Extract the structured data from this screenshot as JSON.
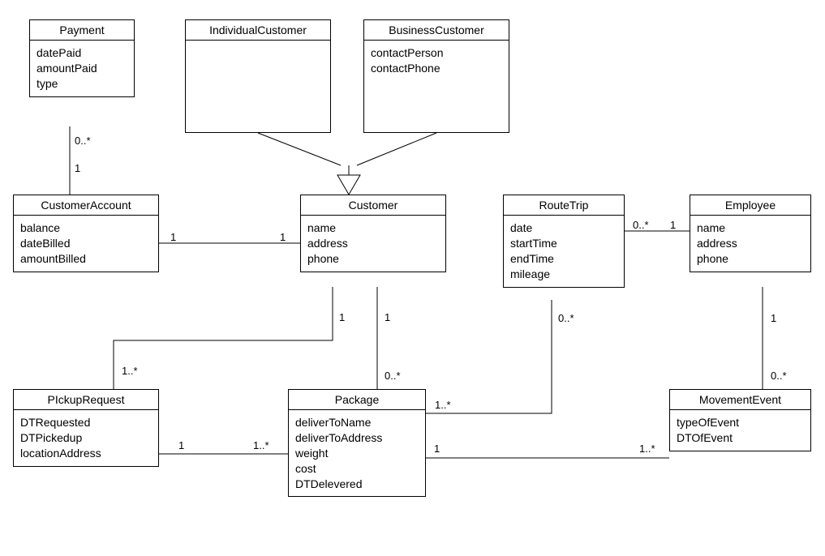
{
  "classes": {
    "payment": {
      "name": "Payment",
      "attributes": [
        "datePaid",
        "amountPaid",
        "type"
      ]
    },
    "individualCustomer": {
      "name": "IndividualCustomer",
      "attributes": []
    },
    "businessCustomer": {
      "name": "BusinessCustomer",
      "attributes": [
        "contactPerson",
        "contactPhone"
      ]
    },
    "customerAccount": {
      "name": "CustomerAccount",
      "attributes": [
        "balance",
        "dateBilled",
        "amountBilled"
      ]
    },
    "customer": {
      "name": "Customer",
      "attributes": [
        "name",
        "address",
        "phone"
      ]
    },
    "routeTrip": {
      "name": "RouteTrip",
      "attributes": [
        "date",
        "startTime",
        "endTime",
        "mileage"
      ]
    },
    "employee": {
      "name": "Employee",
      "attributes": [
        "name",
        "address",
        "phone"
      ]
    },
    "pickupRequest": {
      "name": "PIckupRequest",
      "attributes": [
        "DTRequested",
        "DTPickedup",
        "locationAddress"
      ]
    },
    "package": {
      "name": "Package",
      "attributes": [
        "deliverToName",
        "deliverToAddress",
        "weight",
        "cost",
        "DTDelevered"
      ]
    },
    "movementEvent": {
      "name": "MovementEvent",
      "attributes": [
        "typeOfEvent",
        "DTOfEvent"
      ]
    }
  },
  "associations": {
    "payment_customerAccount": {
      "end1": "0..*",
      "end2": "1"
    },
    "customerAccount_customer": {
      "end1": "1",
      "end2": "1"
    },
    "customer_pickupRequest": {
      "end1": "1",
      "end2": "1..*"
    },
    "customer_package": {
      "end1": "1",
      "end2": "0..*"
    },
    "pickupRequest_package": {
      "end1": "1",
      "end2": "1..*"
    },
    "package_routeTrip": {
      "end1": "1..*",
      "end2": "0..*"
    },
    "routeTrip_employee": {
      "end1": "0..*",
      "end2": "1"
    },
    "package_movementEvent": {
      "end1": "1",
      "end2": "1..*"
    },
    "employee_movementEvent": {
      "end1": "1",
      "end2": "0..*"
    }
  },
  "generalization": {
    "parent": "customer",
    "children": [
      "individualCustomer",
      "businessCustomer"
    ]
  },
  "chart_data": {
    "type": "table",
    "description": "UML class diagram",
    "classes": [
      {
        "name": "Payment",
        "attributes": [
          "datePaid",
          "amountPaid",
          "type"
        ]
      },
      {
        "name": "IndividualCustomer",
        "attributes": []
      },
      {
        "name": "BusinessCustomer",
        "attributes": [
          "contactPerson",
          "contactPhone"
        ]
      },
      {
        "name": "CustomerAccount",
        "attributes": [
          "balance",
          "dateBilled",
          "amountBilled"
        ]
      },
      {
        "name": "Customer",
        "attributes": [
          "name",
          "address",
          "phone"
        ]
      },
      {
        "name": "RouteTrip",
        "attributes": [
          "date",
          "startTime",
          "endTime",
          "mileage"
        ]
      },
      {
        "name": "Employee",
        "attributes": [
          "name",
          "address",
          "phone"
        ]
      },
      {
        "name": "PIckupRequest",
        "attributes": [
          "DTRequested",
          "DTPickedup",
          "locationAddress"
        ]
      },
      {
        "name": "Package",
        "attributes": [
          "deliverToName",
          "deliverToAddress",
          "weight",
          "cost",
          "DTDelevered"
        ]
      },
      {
        "name": "MovementEvent",
        "attributes": [
          "typeOfEvent",
          "DTOfEvent"
        ]
      }
    ],
    "relationships": [
      {
        "from": "Payment",
        "to": "CustomerAccount",
        "from_mult": "0..*",
        "to_mult": "1",
        "type": "association"
      },
      {
        "from": "CustomerAccount",
        "to": "Customer",
        "from_mult": "1",
        "to_mult": "1",
        "type": "association"
      },
      {
        "from": "Customer",
        "to": "PIckupRequest",
        "from_mult": "1",
        "to_mult": "1..*",
        "type": "association"
      },
      {
        "from": "Customer",
        "to": "Package",
        "from_mult": "1",
        "to_mult": "0..*",
        "type": "association"
      },
      {
        "from": "PIckupRequest",
        "to": "Package",
        "from_mult": "1",
        "to_mult": "1..*",
        "type": "association"
      },
      {
        "from": "Package",
        "to": "RouteTrip",
        "from_mult": "1..*",
        "to_mult": "0..*",
        "type": "association"
      },
      {
        "from": "RouteTrip",
        "to": "Employee",
        "from_mult": "0..*",
        "to_mult": "1",
        "type": "association"
      },
      {
        "from": "Package",
        "to": "MovementEvent",
        "from_mult": "1",
        "to_mult": "1..*",
        "type": "association"
      },
      {
        "from": "Employee",
        "to": "MovementEvent",
        "from_mult": "1",
        "to_mult": "0..*",
        "type": "association"
      },
      {
        "from": "IndividualCustomer",
        "to": "Customer",
        "type": "generalization"
      },
      {
        "from": "BusinessCustomer",
        "to": "Customer",
        "type": "generalization"
      }
    ]
  }
}
